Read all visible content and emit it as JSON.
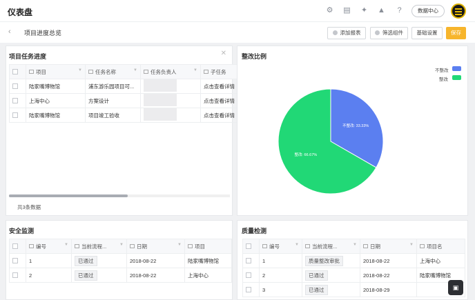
{
  "header": {
    "app_title": "仪表盘",
    "data_center_label": "数据中心",
    "icons": [
      "gear-icon",
      "document-icon",
      "puzzle-icon",
      "bell-icon",
      "help-icon"
    ]
  },
  "subheader": {
    "page_title": "项目进度总览",
    "add_report_label": "添加报表",
    "filter_label": "筛选组件",
    "settings_label": "基础设置",
    "save_label": "保存"
  },
  "task_panel": {
    "title": "项目任务进度",
    "columns": [
      "项目",
      "任务名称",
      "任务负责人",
      "子任务"
    ],
    "rows": [
      {
        "project": "陆家嘴博物馆",
        "task": "浦东游乐园项目可...",
        "sub": "点击查看详情"
      },
      {
        "project": "上海中心",
        "task": "方案设计",
        "sub": "点击查看详情"
      },
      {
        "project": "陆家嘴博物馆",
        "task": "项目竣工验收",
        "sub": "点击查看详情"
      }
    ],
    "record_count": "共3条数据"
  },
  "chart_panel": {
    "title": "整改比例",
    "legend": [
      {
        "label": "不整改",
        "color": "#5b7ff0"
      },
      {
        "label": "整改",
        "color": "#21d876"
      }
    ]
  },
  "chart_data": {
    "type": "pie",
    "title": "整改比例",
    "slices": [
      {
        "label": "不整改",
        "value": 33.33,
        "text": "不整改: 33.33%",
        "color": "#5b7ff0"
      },
      {
        "label": "整改",
        "value": 66.67,
        "text": "整改: 66.67%",
        "color": "#21d876"
      }
    ],
    "legend_position": "top-right"
  },
  "safety_panel": {
    "title": "安全监测",
    "columns": [
      "编号",
      "当前流程...",
      "日期",
      "项目"
    ],
    "rows": [
      {
        "id": "1",
        "status": "已通过",
        "date": "2018-08-22",
        "project": "陆家嘴博物馆"
      },
      {
        "id": "2",
        "status": "已通过",
        "date": "2018-08-22",
        "project": "上海中心"
      }
    ]
  },
  "quality_panel": {
    "title": "质量检测",
    "columns": [
      "编号",
      "当前流程...",
      "日期",
      "项目名"
    ],
    "rows": [
      {
        "id": "1",
        "status": "质量整改审批",
        "date": "2018-08-22",
        "project": "上海中心"
      },
      {
        "id": "2",
        "status": "已通过",
        "date": "2018-08-22",
        "project": "陆家嘴博物馆"
      },
      {
        "id": "3",
        "status": "已通过",
        "date": "2018-08-29",
        "project": ""
      }
    ]
  }
}
